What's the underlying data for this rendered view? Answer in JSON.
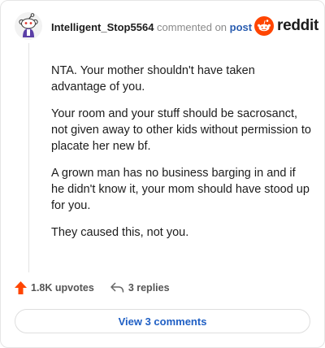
{
  "comment": {
    "username": "Intelligent_Stop5564",
    "commented_text": "commented on",
    "post_link": "post",
    "brand": "reddit",
    "paragraphs": [
      "NTA. Your mother shouldn't have taken advantage of you.",
      "Your room and your stuff should be sacrosanct, not given away to other kids without permission to placate her new bf.",
      "A grown man has no business barging in and if he didn't know it, your mom should have stood up for you.",
      "They caused this, not you."
    ]
  },
  "actions": {
    "upvotes": "1.8K upvotes",
    "replies": "3 replies"
  },
  "view_comments": "View 3 comments",
  "colors": {
    "reddit_orange": "#ff4500",
    "link_blue": "#2a5db0",
    "button_blue": "#1f5fc4"
  },
  "icons": {
    "avatar": "snoo-avatar",
    "logo": "reddit-logo-icon",
    "upvote": "upvote-arrow-icon",
    "reply": "reply-arrow-icon"
  }
}
